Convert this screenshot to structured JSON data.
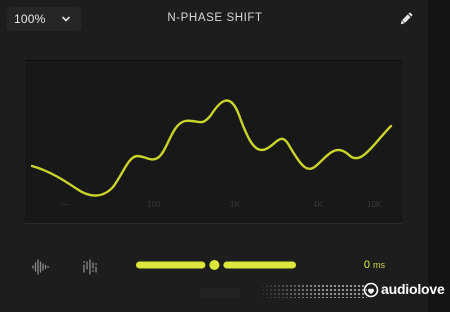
{
  "header": {
    "zoom_value": "100%",
    "title": "N-PHASE SHIFT",
    "edit_icon": "pencil-icon",
    "zoom_chevron_icon": "chevron-down-icon"
  },
  "graph": {
    "curve_color": "#c8d42a",
    "x_tick_labels": [
      "—",
      "100",
      "1K",
      "4K",
      "10K"
    ],
    "side_markers": [
      "·",
      "·",
      "·"
    ]
  },
  "controls": {
    "left_icon": "waveform-icon",
    "right_icon": "waveform-scatter-icon",
    "slider_position": 0.49,
    "slider_color": "#dde63a",
    "delay_value": "0",
    "delay_unit": "ms"
  },
  "watermark": {
    "text": "audiolove",
    "logo_icon": "audiolove-logo-icon"
  },
  "colors": {
    "accent": "#e3f03b",
    "background": "#1d1d1d",
    "panel": "#181818"
  }
}
